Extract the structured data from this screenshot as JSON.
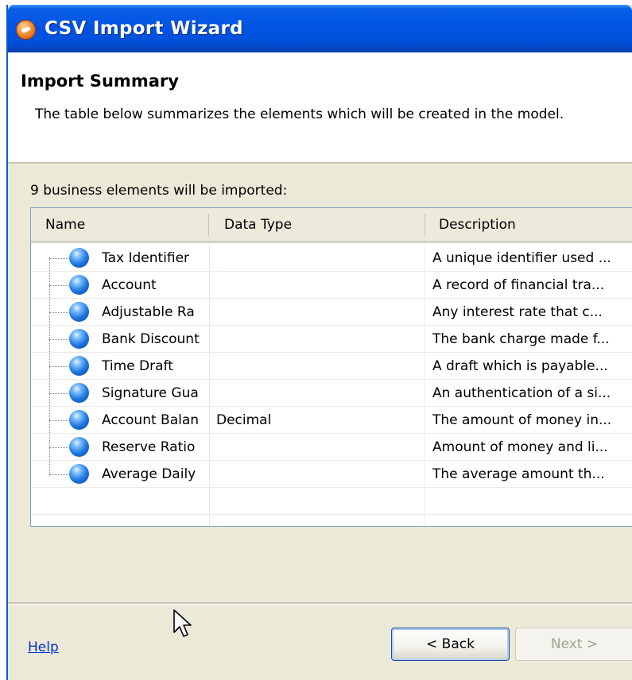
{
  "window": {
    "title": "CSV Import Wizard",
    "app_icon": "csv-import-icon"
  },
  "header": {
    "title": "Import Summary",
    "description": "The table below summarizes the elements which will be created in the model."
  },
  "summary": {
    "count_text": "9 business elements will be imported:"
  },
  "table": {
    "columns": [
      "Name",
      "Data Type",
      "Description"
    ],
    "rows": [
      {
        "name": "Tax Identifier",
        "data_type": "",
        "description": "A unique identifier used ..."
      },
      {
        "name": "Account",
        "data_type": "",
        "description": "A record of financial tra..."
      },
      {
        "name": "Adjustable Ra",
        "data_type": "",
        "description": "Any interest rate that c..."
      },
      {
        "name": "Bank Discount",
        "data_type": "",
        "description": "The bank charge made f..."
      },
      {
        "name": "Time Draft",
        "data_type": "",
        "description": "A draft which is payable..."
      },
      {
        "name": "Signature Gua",
        "data_type": "",
        "description": "An authentication of a si..."
      },
      {
        "name": "Account Balan",
        "data_type": "Decimal",
        "description": "The amount of money in..."
      },
      {
        "name": "Reserve Ratio",
        "data_type": "",
        "description": "Amount of money and li..."
      },
      {
        "name": "Average Daily",
        "data_type": "",
        "description": "The average amount th..."
      }
    ],
    "row_icon": "business-element-sphere-icon"
  },
  "footer": {
    "help_label": "Help",
    "back_label": "< Back",
    "next_label": "Next >"
  },
  "colors": {
    "titlebar": "#0054e3",
    "dialog_bg": "#ece9d8",
    "link": "#0033cc",
    "disabled_text": "#a1a192"
  }
}
